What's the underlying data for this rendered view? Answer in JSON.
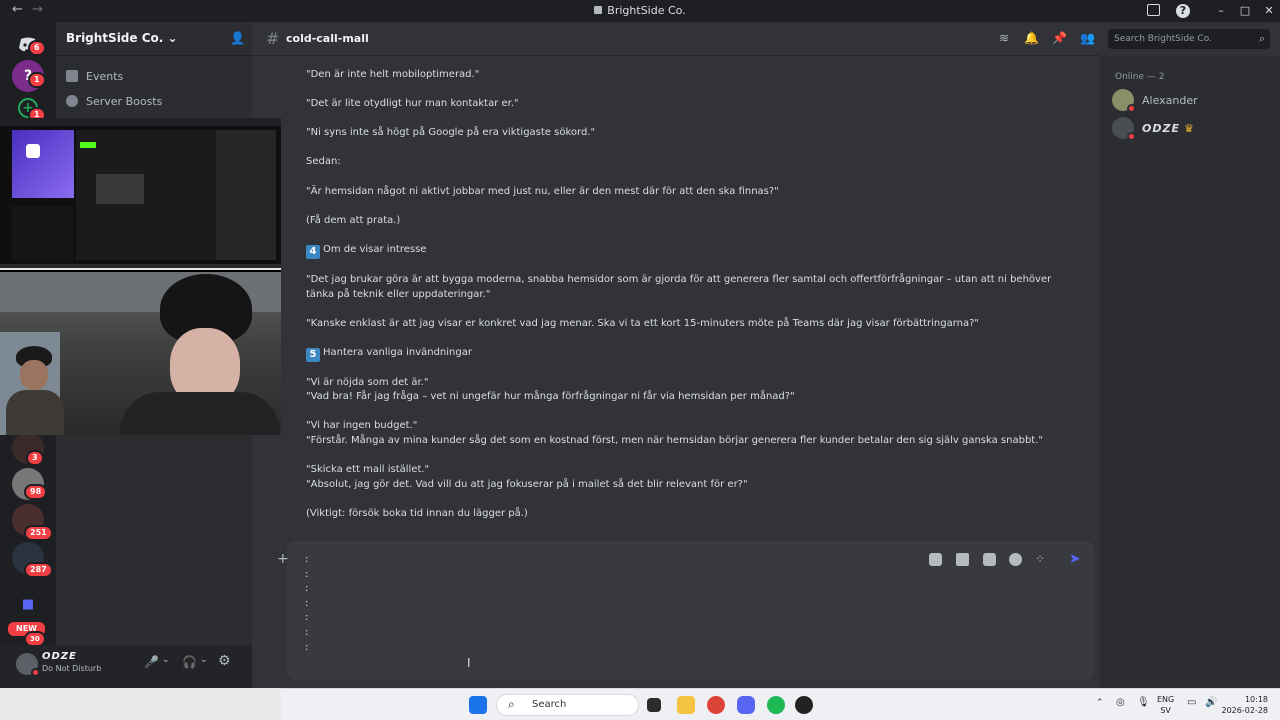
{
  "titlebar": {
    "back": "←",
    "forward": "→",
    "title": "BrightSide Co.",
    "inbox_icon": "inbox-icon",
    "help_icon": "help-icon",
    "minimize": "–",
    "maximize": "□",
    "close": "✕"
  },
  "rail": {
    "home_badge": "6",
    "server_badge": "1",
    "add_badge": "1",
    "counts": [
      "3",
      "98",
      "251",
      "287"
    ],
    "new_label": "NEW",
    "new_count": "30"
  },
  "sidebar": {
    "server_name": "BrightSide Co.",
    "items": [
      {
        "label": "Events",
        "icon": "calendar-icon"
      },
      {
        "label": "Server Boosts",
        "icon": "boost-icon"
      }
    ]
  },
  "user": {
    "name": "ODZE",
    "status": "Do Not Disturb"
  },
  "channel": {
    "hash": "#",
    "name": "cold-call-mall",
    "search_placeholder": "Search BrightSide Co."
  },
  "messages": [
    "\"Den är inte helt mobiloptimerad.\"",
    "\"Det är lite otydligt hur man kontaktar er.\"",
    "\"Ni syns inte så högt på Google på era viktigaste sökord.\"",
    "Sedan:",
    "\"Är hemsidan något ni aktivt jobbar med just nu, eller är den mest där för att den ska finnas?\"",
    "(Få dem att prata.)",
    "Om de visar intresse",
    "\"Det jag brukar göra är att bygga moderna, snabba hemsidor som är gjorda för att generera fler samtal och offertförfrågningar – utan att ni behöver tänka på teknik eller uppdateringar.\"",
    "\"Kanske enklast är att jag visar er konkret vad jag menar. Ska vi ta ett kort 15-minuters möte på Teams där jag visar förbättringarna?\"",
    "Hantera vanliga invändningar",
    "\"Vi är nöjda som det är.\"",
    "\"Vad bra! Får jag fråga – vet ni ungefär hur många förfrågningar ni får via hemsidan per månad?\"",
    "\"Vi har ingen budget.\"",
    "\"Förstår. Många av mina kunder såg det som en kostnad först, men när hemsidan börjar generera fler kunder betalar den sig själv ganska snabbt.\"",
    "\"Skicka ett mail istället.\"",
    "\"Absolut, jag gör det. Vad vill du att jag fokuserar på i mailet så det blir relevant för er?\"",
    "(Viktigt: försök boka tid innan du lägger på.)"
  ],
  "step_numbers": [
    "4",
    "5"
  ],
  "composer": {
    "text": ":\n:\n:\n:\n:\n:\n:"
  },
  "members": {
    "online_label": "Online — 2",
    "list": [
      {
        "name": "Alexander"
      },
      {
        "name": "ODZE",
        "crown": "♛"
      }
    ]
  },
  "taskbar": {
    "search": "Search",
    "lang_top": "ENG",
    "lang_bottom": "SV",
    "time": "10:18",
    "date": "2026-02-28"
  },
  "colors": {
    "accent": "#5865f2",
    "dnd": "#f23f43",
    "number_badge": "#3b88c3"
  }
}
